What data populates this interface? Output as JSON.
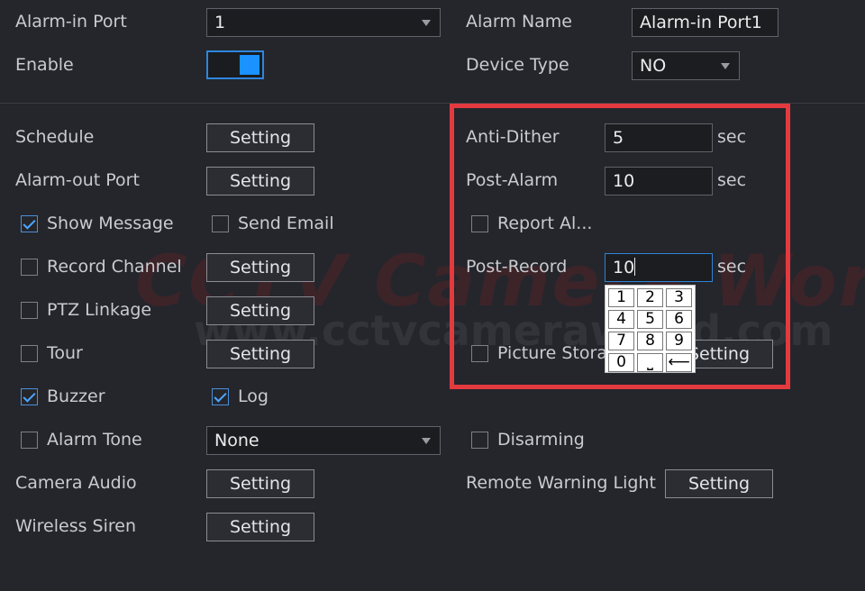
{
  "header": {
    "alarm_in_port_label": "Alarm-in Port",
    "alarm_in_port_value": "1",
    "alarm_name_label": "Alarm Name",
    "alarm_name_value": "Alarm-in Port1",
    "enable_label": "Enable",
    "enable_on": true,
    "device_type_label": "Device Type",
    "device_type_value": "NO"
  },
  "left": {
    "schedule_label": "Schedule",
    "schedule_button": "Setting",
    "alarm_out_label": "Alarm-out Port",
    "alarm_out_button": "Setting",
    "show_message_label": "Show Message",
    "show_message_checked": true,
    "send_email_label": "Send Email",
    "send_email_checked": false,
    "record_channel_label": "Record Channel",
    "record_channel_button": "Setting",
    "ptz_label": "PTZ Linkage",
    "ptz_button": "Setting",
    "tour_label": "Tour",
    "tour_button": "Setting",
    "buzzer_label": "Buzzer",
    "buzzer_checked": true,
    "log_label": "Log",
    "log_checked": true,
    "alarm_tone_label": "Alarm Tone",
    "alarm_tone_value": "None",
    "camera_audio_label": "Camera Audio",
    "camera_audio_button": "Setting",
    "wireless_siren_label": "Wireless Siren",
    "wireless_siren_button": "Setting"
  },
  "right": {
    "anti_dither_label": "Anti-Dither",
    "anti_dither_value": "5",
    "anti_dither_unit": "sec",
    "post_alarm_label": "Post-Alarm",
    "post_alarm_value": "10",
    "post_alarm_unit": "sec",
    "report_alarm_label": "Report Al...",
    "post_record_label": "Post-Record",
    "post_record_value": "10",
    "post_record_unit": "sec",
    "picture_storage_label": "Picture Stora",
    "picture_storage_button": "Setting",
    "disarming_label": "Disarming",
    "remote_warning_label": "Remote Warning Light",
    "remote_warning_button": "Setting"
  },
  "keypad": {
    "keys": [
      "1",
      "2",
      "3",
      "4",
      "5",
      "6",
      "7",
      "8",
      "9",
      "0",
      "⎵",
      "⟵"
    ]
  },
  "watermark": {
    "brand": "CCTV Camera World",
    "url": "www.cctvcameraworld.com"
  },
  "colors": {
    "background": "#24262c",
    "accent": "#2e86de",
    "highlight_box": "#e33a3f"
  }
}
